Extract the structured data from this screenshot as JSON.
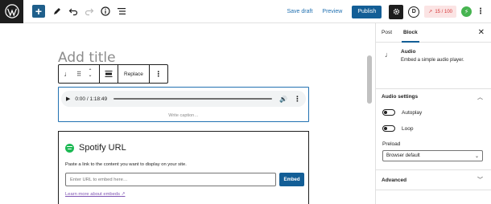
{
  "toolbar": {
    "save_draft": "Save draft",
    "preview": "Preview",
    "publish": "Publish",
    "d_label": "D",
    "score": "15 / 100",
    "green_label": "⚡"
  },
  "editor": {
    "title_placeholder": "Add title",
    "block_toolbar": {
      "replace": "Replace"
    },
    "audio": {
      "time": "0:00 / 1:18:49",
      "caption_placeholder": "Write caption…"
    },
    "embed": {
      "title": "Spotify URL",
      "instructions": "Paste a link to the content you want to display on your site.",
      "input_placeholder": "Enter URL to embed here…",
      "button": "Embed",
      "learn_more": "Learn more about embeds"
    }
  },
  "sidebar": {
    "tabs": [
      "Post",
      "Block"
    ],
    "active_tab": "Block",
    "block": {
      "name": "Audio",
      "description": "Embed a simple audio player."
    },
    "audio_settings": {
      "heading": "Audio settings",
      "autoplay": "Autoplay",
      "loop": "Loop",
      "preload_label": "Preload",
      "preload_value": "Browser default"
    },
    "advanced": "Advanced"
  },
  "colors": {
    "accent": "#135e96",
    "add_button": "#1f5f8b",
    "spotify": "#1db954",
    "score_text": "#d63638"
  }
}
